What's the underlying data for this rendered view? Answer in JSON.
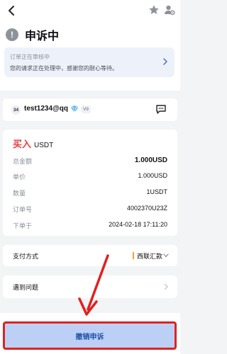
{
  "header": {
    "title": "申诉中",
    "icons": {
      "back": "back-arrow-icon",
      "favorite": "star-icon",
      "profile": "user-settings-icon",
      "alert": "exclamation-icon"
    }
  },
  "notice": {
    "line1": "订单正在审核中",
    "line2": "您的请求正在处理中，感谢您的耐心等待。"
  },
  "user": {
    "badge": "34",
    "name": "test1234@qq",
    "level": "V0"
  },
  "order": {
    "side": "买入",
    "coin": "USDT",
    "rows": [
      {
        "key": "总金额",
        "value": "1.000USD"
      },
      {
        "key": "单价",
        "value": "1.000USD"
      },
      {
        "key": "数量",
        "value": "1USDT"
      },
      {
        "key": "订单号",
        "value": "4002370U23Z"
      },
      {
        "key": "下单于",
        "value": "2024-02-18 17:11:20"
      }
    ]
  },
  "payment": {
    "label": "支付方式",
    "method": "西联汇款"
  },
  "issue": {
    "label": "遇到问题"
  },
  "actions": {
    "cancel_appeal": "撤销申诉"
  },
  "colors": {
    "buy_red": "#e63b3b",
    "highlight_red": "#e0221f",
    "button_bg": "#bcd0f5",
    "payment_accent": "#f3a22e"
  }
}
